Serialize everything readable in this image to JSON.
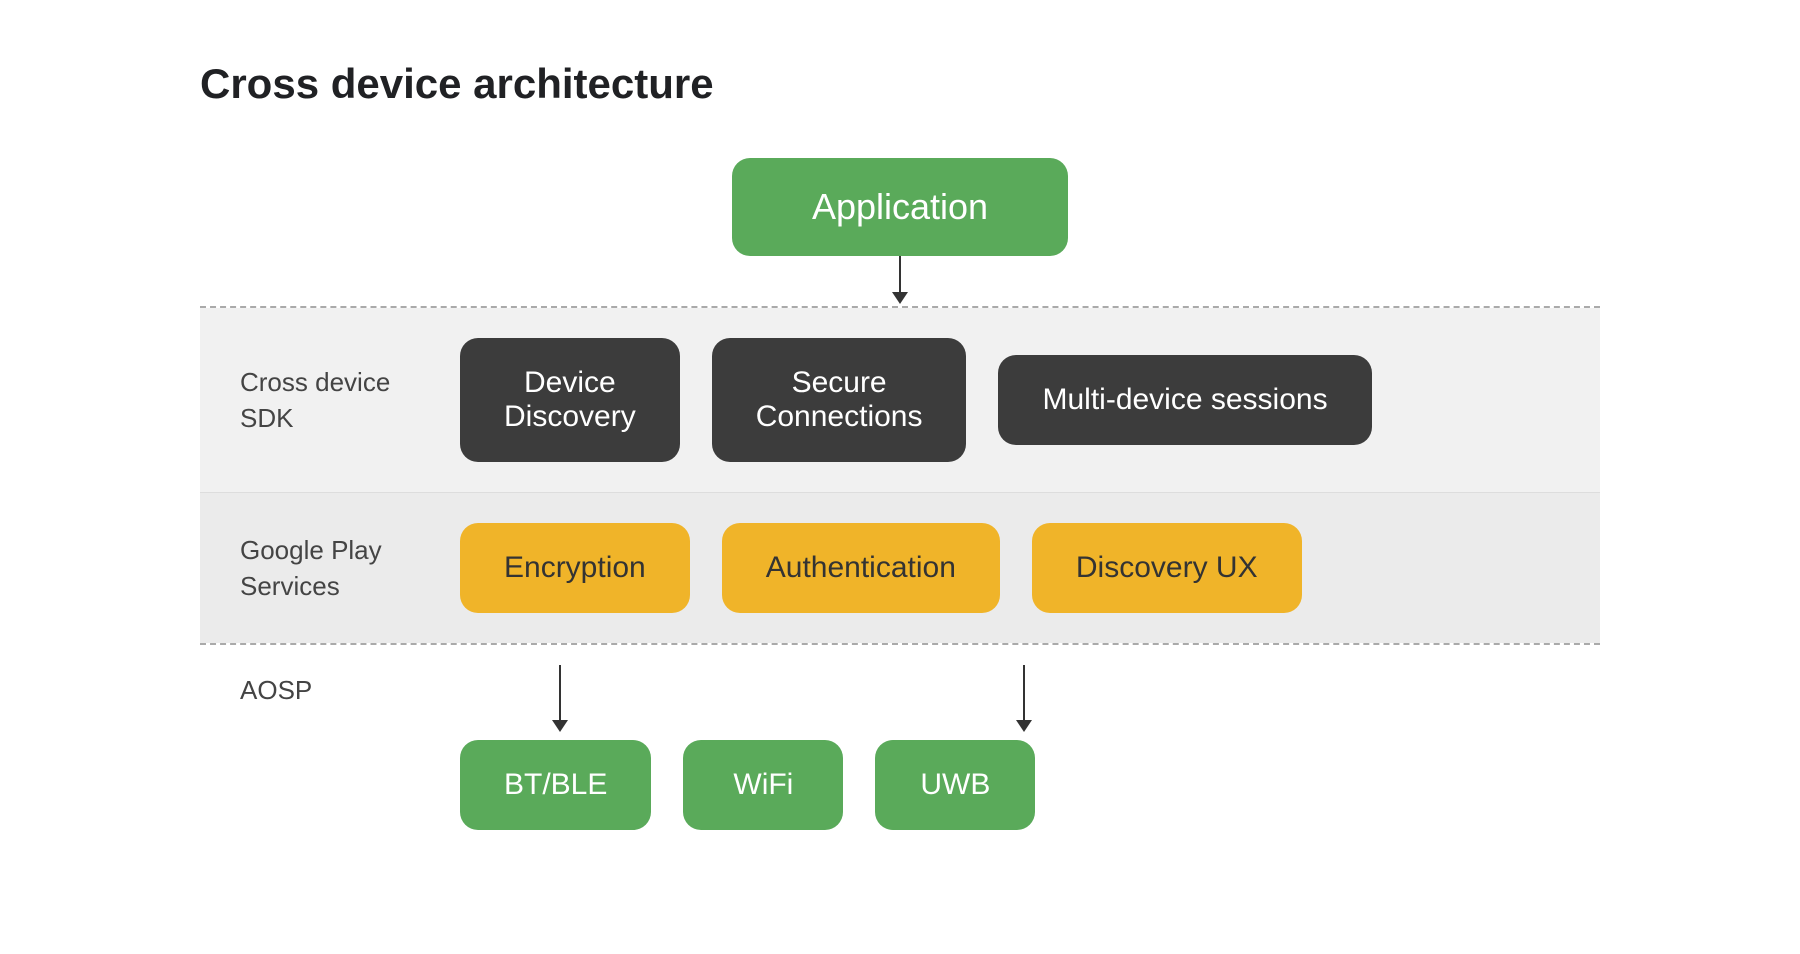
{
  "title": "Cross device architecture",
  "application": {
    "label": "Application"
  },
  "sdk_section": {
    "label": "Cross device\nSDK",
    "boxes": [
      {
        "id": "device-discovery",
        "text": "Device\nDiscovery"
      },
      {
        "id": "secure-connections",
        "text": "Secure\nConnections"
      },
      {
        "id": "multi-device-sessions",
        "text": "Multi-device sessions"
      }
    ]
  },
  "gps_section": {
    "label": "Google Play\nServices",
    "boxes": [
      {
        "id": "encryption",
        "text": "Encryption"
      },
      {
        "id": "authentication",
        "text": "Authentication"
      },
      {
        "id": "discovery-ux",
        "text": "Discovery UX"
      }
    ]
  },
  "aosp_section": {
    "label": "AOSP",
    "bottom_boxes": [
      {
        "id": "bt-ble",
        "text": "BT/BLE"
      },
      {
        "id": "wifi",
        "text": "WiFi"
      },
      {
        "id": "uwb",
        "text": "UWB"
      }
    ]
  },
  "colors": {
    "green": "#5aaa5a",
    "dark": "#3c3c3c",
    "yellow": "#f0b429",
    "bg_section": "#f1f1f1",
    "bg_gps": "#ebebeb"
  }
}
